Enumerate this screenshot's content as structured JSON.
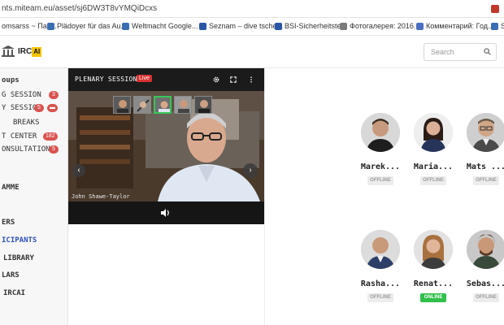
{
  "browser": {
    "url": "nts.miteam.eu/asset/sj6DW3T8vYMQiDcxs",
    "bookmarks": [
      {
        "label": "omsarss ~ Пас..."
      },
      {
        "label": "Plädoyer für das Au..."
      },
      {
        "label": "Weltmacht Google..."
      },
      {
        "label": "Seznam – dive tsche..."
      },
      {
        "label": "BSI-Sicherheitstest"
      },
      {
        "label": "Фотогалерея: 2016..."
      },
      {
        "label": "Комментарий: Год..."
      },
      {
        "label": "S"
      }
    ]
  },
  "header": {
    "logo_text": "IRC",
    "logo_badge": "AI",
    "search_placeholder": "Search"
  },
  "sidebar": {
    "items": [
      {
        "label": "oups",
        "badge": ""
      },
      {
        "label": "G SESSION",
        "badge": "3"
      },
      {
        "label": "Y SESSION",
        "badge": "5"
      },
      {
        "label": "BREAKS",
        "badge": ""
      },
      {
        "label": "T CENTER",
        "badge": "182"
      },
      {
        "label": "ONSULTATION",
        "badge": "5"
      },
      {
        "label": "AMME",
        "badge": ""
      },
      {
        "label": "ERS",
        "badge": ""
      },
      {
        "label": "ICIPANTS",
        "badge": ""
      },
      {
        "label": "LIBRARY",
        "badge": ""
      },
      {
        "label": "LARS",
        "badge": ""
      },
      {
        "label": "IRCAI",
        "badge": ""
      }
    ]
  },
  "video": {
    "title": "PLENARY SESSION",
    "live_label": "Live",
    "speaker": "John Shawe-Taylor"
  },
  "participants": [
    {
      "name": "Marek...",
      "status": "OFFLINE"
    },
    {
      "name": "Maria...",
      "status": "OFFLINE"
    },
    {
      "name": "Mats ...",
      "status": "OFFLINE"
    },
    {
      "name": "Rasha...",
      "status": "OFFLINE"
    },
    {
      "name": "Renat...",
      "status": "ONLINE"
    },
    {
      "name": "Sebas...",
      "status": "OFFLINE"
    }
  ],
  "colors": {
    "accent": "#2f4fb5",
    "badge": "#d9534f",
    "live": "#d83232",
    "online": "#2fbf4a",
    "logo_badge": "#f2c500"
  }
}
